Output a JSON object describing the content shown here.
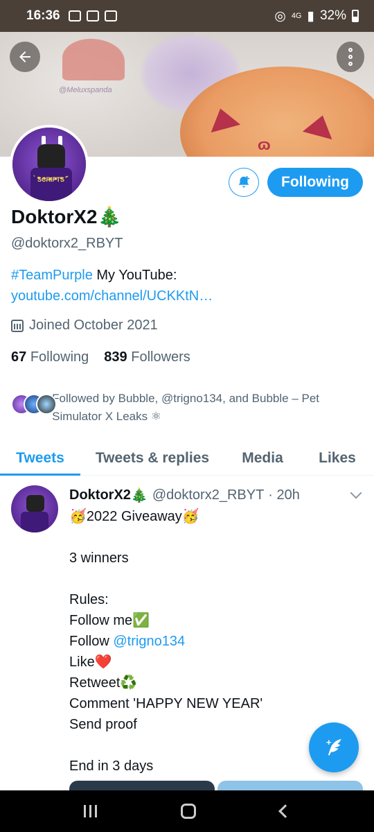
{
  "status_bar": {
    "time": "16:36",
    "network": "4G",
    "battery": "32%"
  },
  "banner": {
    "signature": "@Meluxspanda"
  },
  "profile": {
    "display_name": "DoktorX2",
    "name_emoji": "🎄",
    "handle": "@doktorx2_RBYT",
    "bio_hashtag": "#TeamPurple",
    "bio_text": " My YouTube: ",
    "bio_link": "youtube.com/channel/UCKKtN…",
    "joined": "Joined October 2021",
    "following_count": "67",
    "following_label": "Following",
    "followers_count": "839",
    "followers_label": "Followers",
    "followed_by": "Followed by Bubble, @trigno134, and Bubble – Pet Simulator X Leaks ⚛"
  },
  "actions": {
    "following_button": "Following"
  },
  "tabs": [
    {
      "label": "Tweets",
      "active": true
    },
    {
      "label": "Tweets & replies",
      "active": false
    },
    {
      "label": "Media",
      "active": false
    },
    {
      "label": "Likes",
      "active": false
    }
  ],
  "tweet": {
    "name": "DoktorX2",
    "name_emoji": "🎄",
    "handle": "@doktorx2_RBYT",
    "time": "· 20h",
    "lines": [
      "🥳2022 Giveaway🥳",
      "",
      "3 winners",
      "",
      "Rules:",
      "Follow me✅",
      "Follow ",
      "Like❤️",
      "Retweet♻️",
      "Comment 'HAPPY NEW YEAR'",
      "Send proof",
      "",
      "End in 3 days"
    ],
    "mention": "@trigno134"
  },
  "colors": {
    "accent": "#1d9bf0",
    "secondary_text": "#536471",
    "status_bar": "#4a4038"
  }
}
